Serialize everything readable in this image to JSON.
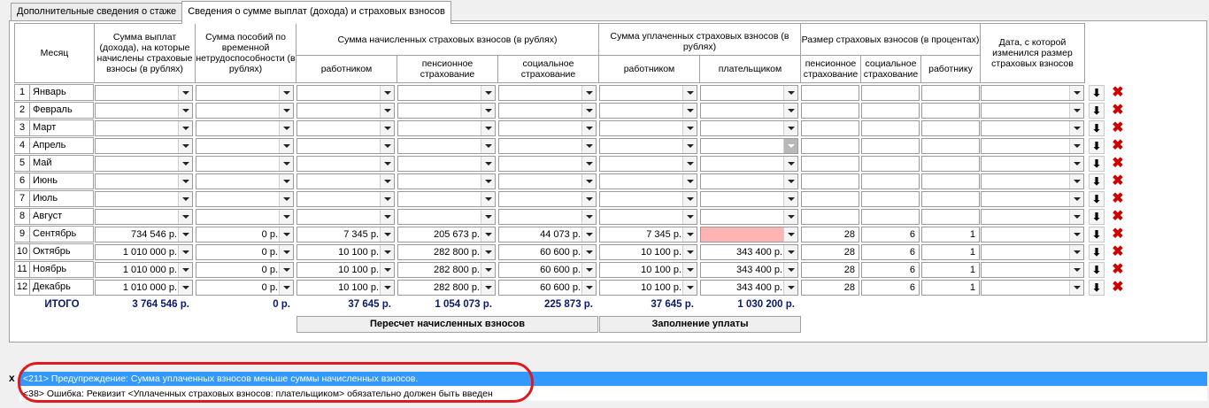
{
  "tabs": [
    {
      "label": "Дополнительные сведения о стаже",
      "active": false
    },
    {
      "label": "Сведения о сумме выплат (дохода) и страховых взносов",
      "active": true
    }
  ],
  "headers": {
    "month": "Месяц",
    "payments": "Сумма выплат (дохода), на которые начислены страховые взносы (в рублях)",
    "benefits": "Сумма пособий по временной нетрудоспособности (в рублях)",
    "accrued_group": "Сумма начисленных страховых взносов (в рублях)",
    "accrued_employee": "работником",
    "accrued_pension": "пенсионное страхование",
    "accrued_social": "социальное страхование",
    "paid_group": "Сумма уплаченных страховых взносов (в рублях)",
    "paid_employee": "работником",
    "paid_payer": "плательщиком",
    "rate_group": "Размер страховых взносов (в процентах)",
    "rate_pension": "пенсионное страхование",
    "rate_social": "социальное страхование",
    "rate_employee": "работнику",
    "date_changed": "Дата, с которой изменился размер страховых взносов"
  },
  "rows": [
    {
      "n": "1",
      "month": "Январь",
      "v": [
        "",
        "",
        "",
        "",
        "",
        "",
        "",
        "",
        "",
        "",
        ""
      ]
    },
    {
      "n": "2",
      "month": "Февраль",
      "v": [
        "",
        "",
        "",
        "",
        "",
        "",
        "",
        "",
        "",
        "",
        ""
      ]
    },
    {
      "n": "3",
      "month": "Март",
      "v": [
        "",
        "",
        "",
        "",
        "",
        "",
        "",
        "",
        "",
        "",
        ""
      ]
    },
    {
      "n": "4",
      "month": "Апрель",
      "v": [
        "",
        "",
        "",
        "",
        "",
        "",
        "",
        "",
        "",
        "",
        ""
      ]
    },
    {
      "n": "5",
      "month": "Май",
      "v": [
        "",
        "",
        "",
        "",
        "",
        "",
        "",
        "",
        "",
        "",
        ""
      ]
    },
    {
      "n": "6",
      "month": "Июнь",
      "v": [
        "",
        "",
        "",
        "",
        "",
        "",
        "",
        "",
        "",
        "",
        ""
      ]
    },
    {
      "n": "7",
      "month": "Июль",
      "v": [
        "",
        "",
        "",
        "",
        "",
        "",
        "",
        "",
        "",
        "",
        ""
      ]
    },
    {
      "n": "8",
      "month": "Август",
      "v": [
        "",
        "",
        "",
        "",
        "",
        "",
        "",
        "",
        "",
        "",
        ""
      ]
    },
    {
      "n": "9",
      "month": "Сентябрь",
      "v": [
        "734 546 р.",
        "0 р.",
        "7 345 р.",
        "205 673 р.",
        "44 073 р.",
        "7 345 р.",
        "",
        "28",
        "6",
        "1",
        ""
      ]
    },
    {
      "n": "10",
      "month": "Октябрь",
      "v": [
        "1 010 000 р.",
        "0 р.",
        "10 100 р.",
        "282 800 р.",
        "60 600 р.",
        "10 100 р.",
        "343 400 р.",
        "28",
        "6",
        "1",
        ""
      ]
    },
    {
      "n": "11",
      "month": "Ноябрь",
      "v": [
        "1 010 000 р.",
        "0 р.",
        "10 100 р.",
        "282 800 р.",
        "60 600 р.",
        "10 100 р.",
        "343 400 р.",
        "28",
        "6",
        "1",
        ""
      ]
    },
    {
      "n": "12",
      "month": "Декабрь",
      "v": [
        "1 010 000 р.",
        "0 р.",
        "10 100 р.",
        "282 800 р.",
        "60 600 р.",
        "10 100 р.",
        "343 400 р.",
        "28",
        "6",
        "1",
        ""
      ]
    }
  ],
  "totals": {
    "label": "ИТОГО",
    "values": [
      "3 764 546 р.",
      "0 р.",
      "37 645 р.",
      "1 054 073 р.",
      "225 873 р.",
      "37 645 р.",
      "1 030 200 р."
    ]
  },
  "buttons": {
    "recalc": "Пересчет начисленных взносов",
    "fill_payment": "Заполнение уплаты",
    "move_down_icon": "arrow-down-icon",
    "delete_icon": "red-x-icon"
  },
  "messages": {
    "close": "x",
    "items": [
      {
        "text": "<211> Предупреждение: Сумма уплаченных взносов меньше суммы начисленных взносов.",
        "selected": true
      },
      {
        "text": "<38> Ошибка: Реквизит <Уплаченных страховых взносов: плательщиком> обязательно должен быть введен",
        "selected": false
      }
    ]
  },
  "colors": {
    "invalid_cell": "#ffb3b3",
    "totals_text": "#0a1a6a",
    "highlight": "#e0191e",
    "selection": "#3399ff"
  }
}
